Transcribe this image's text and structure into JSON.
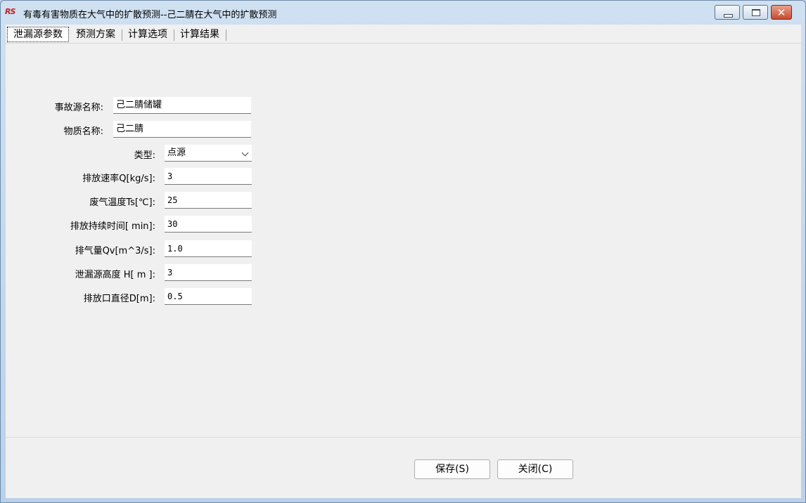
{
  "window": {
    "title": "有毒有害物质在大气中的扩散预测--己二腈在大气中的扩散预测",
    "icon_text": "RS",
    "close_symbol": "✕"
  },
  "tabs": [
    {
      "label": "泄漏源参数",
      "active": true
    },
    {
      "label": "预测方案"
    },
    {
      "label": "计算选项"
    },
    {
      "label": "计算结果"
    }
  ],
  "form": {
    "source_name": {
      "label": "事故源名称:",
      "value": "己二腈储罐"
    },
    "material_name": {
      "label": "物质名称:",
      "value": "己二腈"
    },
    "type": {
      "label": "类型:",
      "value": "点源"
    },
    "discharge_rate": {
      "label": "排放速率Q[kg/s]:",
      "value": "3"
    },
    "gas_temperature": {
      "label": "废气温度Ts[℃]:",
      "value": "25"
    },
    "duration": {
      "label": "排放持续时间[ min]:",
      "value": "30"
    },
    "gas_volume": {
      "label": "排气量Qv[m^3/s]:",
      "value": "1.0"
    },
    "leak_height": {
      "label": "泄漏源高度 H[  m ]:",
      "value": "3"
    },
    "outlet_diameter": {
      "label": "排放口直径D[m]:",
      "value": "0.5"
    }
  },
  "buttons": {
    "save": "保存(S)",
    "close": "关闭(C)"
  },
  "colors": {
    "title_gradient_top": "#cfe0f1",
    "close_button": "#c64c2f",
    "panel": "#f0f0f0"
  }
}
